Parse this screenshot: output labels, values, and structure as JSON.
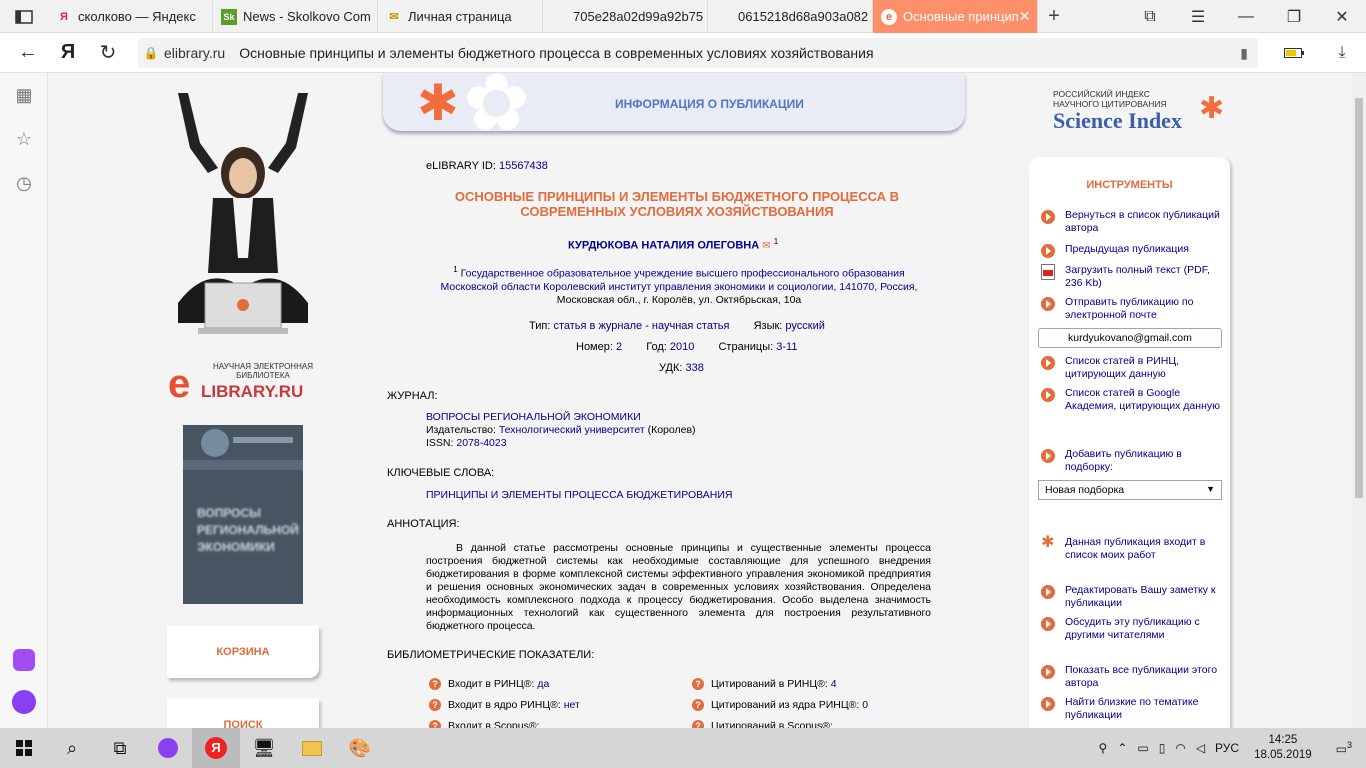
{
  "browser": {
    "tabs": [
      {
        "title": "сколково — Яндекс",
        "icon": "Я"
      },
      {
        "title": "News - Skolkovo Com",
        "icon": "Sk"
      },
      {
        "title": "Личная страница",
        "icon": "✉"
      },
      {
        "title": "705e28a02d99a92b75",
        "icon": ""
      },
      {
        "title": "0615218d68a903a082",
        "icon": ""
      },
      {
        "title": "Основные принцип",
        "icon": "e",
        "active": true
      }
    ],
    "url_domain": "elibrary.ru",
    "page_title": "Основные принципы и элементы бюджетного процесса в современных условиях хозяйствования",
    "yandex_logo": "Я"
  },
  "left": {
    "elibrary_small": "НАУЧНАЯ ЭЛЕКТРОННАЯ БИБЛИОТЕКА",
    "elibrary_big": "LIBRARY.RU",
    "cover_text": "ВОПРОСЫ РЕГИОНАЛЬНОЙ ЭКОНОМИКИ",
    "buttons": [
      "КОРЗИНА",
      "ПОИСК"
    ]
  },
  "header": {
    "title": "ИНФОРМАЦИЯ О ПУБЛИКАЦИИ"
  },
  "pub": {
    "id_label": "eLIBRARY ID:",
    "id_value": "15567438",
    "title_line1": "ОСНОВНЫЕ ПРИНЦИПЫ И ЭЛЕМЕНТЫ БЮДЖЕТНОГО ПРОЦЕССА В",
    "title_line2": "СОВРЕМЕННЫХ УСЛОВИЯХ ХОЗЯЙСТВОВАНИЯ",
    "author": "КУРДЮКОВА НАТАЛИЯ ОЛЕГОВНА",
    "author_sup": "1",
    "aff_sup": "1",
    "aff_line1": "Государственное образовательное учреждение высшего профессионального образования",
    "aff_line2": "Московской области Королевский институт управления экономики и социологии, 141070, Россия,",
    "aff_line3": "Московская обл., г. Королёв, ул. Октябрьская, 10а",
    "type_label": "Тип:",
    "type_value": "статья в журнале - научная статья",
    "lang_label": "Язык:",
    "lang_value": "русский",
    "num_label": "Номер:",
    "num_value": "2",
    "year_label": "Год:",
    "year_value": "2010",
    "pages_label": "Страницы:",
    "pages_value": "3-11",
    "udk_label": "УДК:",
    "udk_value": "338",
    "journal_head": "ЖУРНАЛ:",
    "journal_name": "ВОПРОСЫ РЕГИОНАЛЬНОЙ ЭКОНОМИКИ",
    "publisher_label": "Издательство:",
    "publisher_value": "Технологический университет",
    "publisher_city": "(Королев)",
    "issn_label": "ISSN:",
    "issn_value": "2078-4023",
    "keywords_head": "КЛЮЧЕВЫЕ СЛОВА:",
    "keywords": "ПРИНЦИПЫ И ЭЛЕМЕНТЫ ПРОЦЕССА БЮДЖЕТИРОВАНИЯ",
    "abstract_head": "АННОТАЦИЯ:",
    "abstract": "В данной статье рассмотрены основные принципы и существенные элементы процесса построения бюджетной системы как необходимые составляющие для успешного внедрения бюджетирования в форме комплексной системы эффективного управления экономикой предприятия и решения основных экономических задач в современных условиях хозяйствования. Определена необходимость комплексного подхода к процессу бюджетирования. Особо выделена значимость информационных технологий как существенного элемента для построения результативного бюджетного процесса.",
    "biblio_head": "БИБЛИОМЕТРИЧЕСКИЕ ПОКАЗАТЕЛИ:",
    "biblio": [
      {
        "label": "Входит в РИНЦ®:",
        "value": "да"
      },
      {
        "label": "Цитирований в РИНЦ®:",
        "value": "4"
      },
      {
        "label": "Входит в ядро РИНЦ®:",
        "value": "нет"
      },
      {
        "label": "Цитирований из ядра РИНЦ®:",
        "value": "0"
      },
      {
        "label": "Входит в Scopus®:",
        "value": ""
      },
      {
        "label": "Цитирований в Scopus®:",
        "value": ""
      }
    ]
  },
  "right": {
    "sci_small1": "РОССИЙСКИЙ ИНДЕКС",
    "sci_small2": "НАУЧНОГО ЦИТИРОВАНИЯ",
    "sci_big": "Science Index",
    "tools_head": "ИНСТРУМЕНТЫ",
    "items": [
      "Вернуться в список публикаций автора",
      "Предыдущая публикация",
      "Загрузить полный текст (PDF, 236 Kb)",
      "Отправить публикацию по электронной почте",
      "Список статей в РИНЦ, цитирующих данную",
      "Список статей в Google Академия, цитирующих данную",
      "Добавить публикацию в подборку:",
      "Данная публикация входит в список моих работ",
      "Редактировать Вашу заметку к публикации",
      "Обсудить эту публикацию с другими читателями",
      "Показать все публикации этого автора",
      "Найти близкие по тематике публикации"
    ],
    "email": "kurdyukovano@gmail.com",
    "select": "Новая подборка"
  },
  "taskbar": {
    "lang": "РУС",
    "time": "14:25",
    "date": "18.05.2019",
    "notif": "3"
  }
}
